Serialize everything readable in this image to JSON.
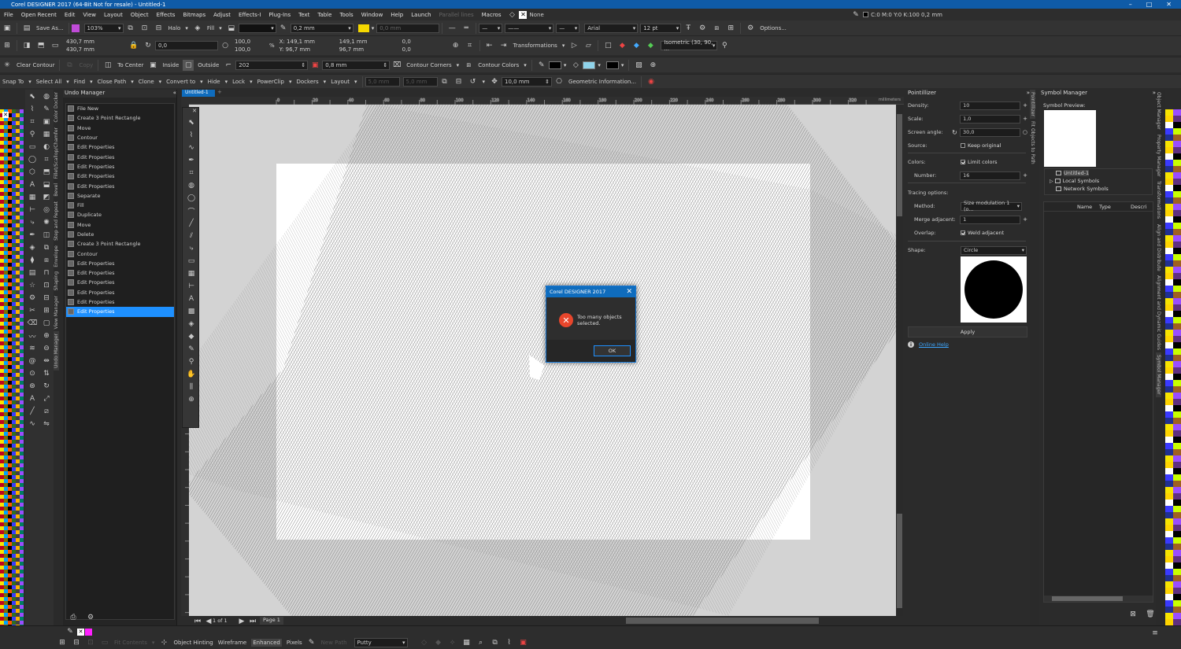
{
  "window": {
    "title": "Corel DESIGNER 2017 (64-Bit Not for resale) - Untitled-1",
    "status_color": "C:0 M:0 Y:0 K:100  0,2 mm",
    "fill_none": "None",
    "fill_swatch_none_label": "None"
  },
  "menu": [
    "File",
    "Open Recent",
    "Edit",
    "View",
    "Layout",
    "Object",
    "Effects",
    "Bitmaps",
    "Adjust",
    "Effects-I",
    "Plug-Ins",
    "Text",
    "Table",
    "Tools",
    "Window",
    "Help",
    "Launch",
    "Parallel lines",
    "Macros"
  ],
  "toolbar1": {
    "save_as": "Save As...",
    "zoom": "103%",
    "halo": "Halo",
    "fill": "Fill",
    "line_width": "0,2 mm",
    "font": "Arial",
    "font_size": "12 pt",
    "options": "Options..."
  },
  "toolbar2": {
    "w1": "430,7 mm",
    "h1": "430,7 mm",
    "angle": "0,0",
    "sx": "100,0",
    "sy": "100,0",
    "x": "149,1 mm",
    "y": "96,7 mm",
    "x2": "149,1 mm",
    "y2": "96,7 mm",
    "sk1": "0,0",
    "sk2": "0,0",
    "transformations": "Transformations",
    "isometric": "Isometric (30, 90, ..."
  },
  "toolbar3": {
    "clear_contour": "Clear Contour",
    "copy": "Copy",
    "to_center": "To Center",
    "inside": "Inside",
    "outside": "Outside",
    "steps": "202",
    "offset": "0,8 mm",
    "contour_corners": "Contour Corners",
    "contour_colors": "Contour Colors"
  },
  "toolbar4": {
    "snap_to": "Snap To",
    "select_all": "Select All",
    "find": "Find",
    "close_path": "Close Path",
    "clone": "Clone",
    "convert_to": "Convert to",
    "hide": "Hide",
    "lock": "Lock",
    "powerclip": "PowerClip",
    "dockers": "Dockers",
    "layout": "Layout",
    "v1": "5,0 mm",
    "v2": "5,0 mm",
    "nudge": "10,0 mm",
    "geometric_info": "Geometric Information..."
  },
  "undo_manager": {
    "title": "Undo Manager",
    "items": [
      "File New",
      "Create 3 Point Rectangle",
      "Move",
      "Contour",
      "Edit Properties",
      "Edit Properties",
      "Edit Properties",
      "Edit Properties",
      "Edit Properties",
      "Separate",
      "Fill",
      "Duplicate",
      "Move",
      "Delete",
      "Create 3 Point Rectangle",
      "Contour",
      "Edit Properties",
      "Edit Properties",
      "Edit Properties",
      "Edit Properties",
      "Edit Properties",
      "Edit Properties"
    ],
    "selected_index": 21
  },
  "left_tabs": [
    "Color Docker",
    "Fillet/Scallop/Chamfer",
    "Bevel",
    "Step and Repeat",
    "Envelope",
    "Shaping",
    "View Manager",
    "Undo Manager"
  ],
  "document": {
    "tab": "Untitled-1",
    "ruler_units": "millimeters",
    "ruler_ticks": [
      "0",
      "10",
      "20",
      "30",
      "40",
      "50",
      "60",
      "70",
      "80",
      "90",
      "100",
      "110",
      "120",
      "130",
      "140",
      "150",
      "160",
      "170",
      "180",
      "190",
      "200",
      "210",
      "220",
      "230",
      "240",
      "250",
      "260",
      "270",
      "280",
      "290",
      "300",
      "310",
      "320",
      "330"
    ],
    "page_nav": "1 of 1",
    "page_tab": "Page 1"
  },
  "dialog": {
    "title": "Corel DESIGNER 2017",
    "message_line1": "Too many objects",
    "message_line2": "selected.",
    "ok": "OK"
  },
  "pointillizer": {
    "title": "Pointillizer",
    "density_label": "Density:",
    "density": "10",
    "scale_label": "Scale:",
    "scale": "1,0",
    "screen_angle_label": "Screen angle:",
    "screen_angle": "30,0",
    "source_label": "Source:",
    "keep_original": "Keep original",
    "colors_label": "Colors:",
    "limit_colors": "Limit colors",
    "number_label": "Number:",
    "number": "16",
    "tracing_options": "Tracing options:",
    "method_label": "Method:",
    "method": "Size modulation 1 (o...",
    "merge_label": "Merge adjacent:",
    "merge": "1",
    "overlap_label": "Overlap:",
    "weld_adjacent": "Weld adjacent",
    "shape_label": "Shape:",
    "shape": "Circle",
    "apply": "Apply",
    "online_help": "Online Help"
  },
  "right_tabs": [
    "Pointillizer",
    "Fit Objects to Path"
  ],
  "symbol_manager": {
    "title": "Symbol Manager",
    "preview": "Symbol Preview:",
    "tree": [
      "Untitled-1",
      "Local Symbols",
      "Network Symbols"
    ],
    "columns": [
      "Name",
      "Type",
      "Descri"
    ]
  },
  "far_right_tabs": [
    "Object Manager",
    "Property Manager",
    "Transformations",
    "Align and Distribute",
    "Alignment and Dynamic Guides",
    "Symbol Manager"
  ],
  "statusbar": {
    "fit_contents": "Fit Contents",
    "object_hinting": "Object Hinting",
    "wireframe": "Wireframe",
    "enhanced": "Enhanced",
    "pixels": "Pixels",
    "new_path": "New Path",
    "putty": "Putty"
  },
  "colors": {
    "accent": "#0f6cbd",
    "selection": "#1e90ff",
    "error": "#e8462c",
    "fill_yellow": "#f5d800",
    "outline_cyan": "#5ec8e6"
  }
}
